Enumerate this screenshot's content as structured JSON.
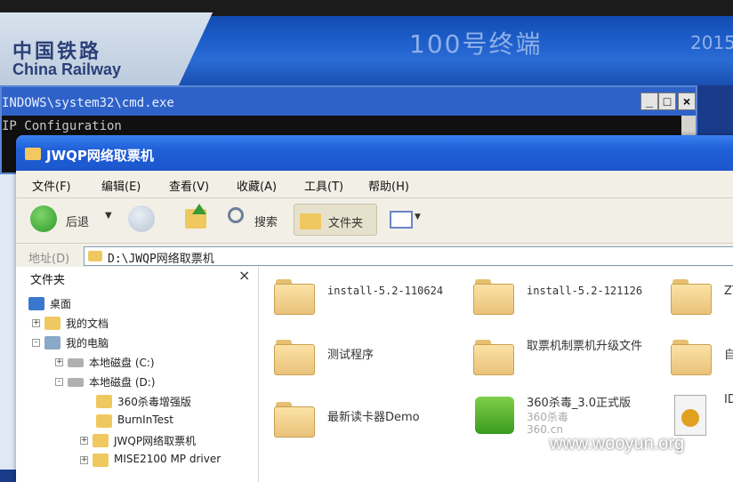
{
  "banner": {
    "logo_cn": "中国铁路",
    "logo_en": "China Railway",
    "terminal_title": "100号终端",
    "year": "2015"
  },
  "cmd": {
    "title": "INDOWS\\system32\\cmd.exe",
    "line1": "IP Configuration",
    "buttons": {
      "minimize": "_",
      "maximize": "□",
      "close": "×"
    }
  },
  "explorer": {
    "title": "JWQP网络取票机",
    "menu": [
      "文件(F)",
      "编辑(E)",
      "查看(V)",
      "收藏(A)",
      "工具(T)",
      "帮助(H)"
    ],
    "toolbar": {
      "back": "后退",
      "search": "搜索",
      "folders": "文件夹"
    },
    "address": {
      "label": "地址(D)",
      "path": "D:\\JWQP网络取票机"
    },
    "pane": {
      "title": "文件夹",
      "close": "×",
      "tree": [
        {
          "label": "桌面"
        },
        {
          "label": "我的文档",
          "exp": "+"
        },
        {
          "label": "我的电脑",
          "exp": "-"
        },
        {
          "label": "本地磁盘 (C:)",
          "exp": "+"
        },
        {
          "label": "本地磁盘 (D:)",
          "exp": "-"
        },
        {
          "label": "360杀毒增强版"
        },
        {
          "label": "BurnInTest"
        },
        {
          "label": "JWQP网络取票机",
          "exp": "+"
        },
        {
          "label": "MISE2100 MP driver",
          "exp": "+"
        }
      ]
    },
    "files": [
      {
        "name": "install-5.2-110624"
      },
      {
        "name": "install-5.2-121126"
      },
      {
        "name": "ZY"
      },
      {
        "name": "测试程序"
      },
      {
        "name": "取票机制票机升级文件"
      },
      {
        "name": "自"
      },
      {
        "name": "最新读卡器Demo"
      },
      {
        "name": "360杀毒_3.0正式版",
        "sub1": "360杀毒",
        "sub2": "360.cn"
      },
      {
        "name": "ID"
      }
    ]
  },
  "watermark": "www.wooyun.org"
}
